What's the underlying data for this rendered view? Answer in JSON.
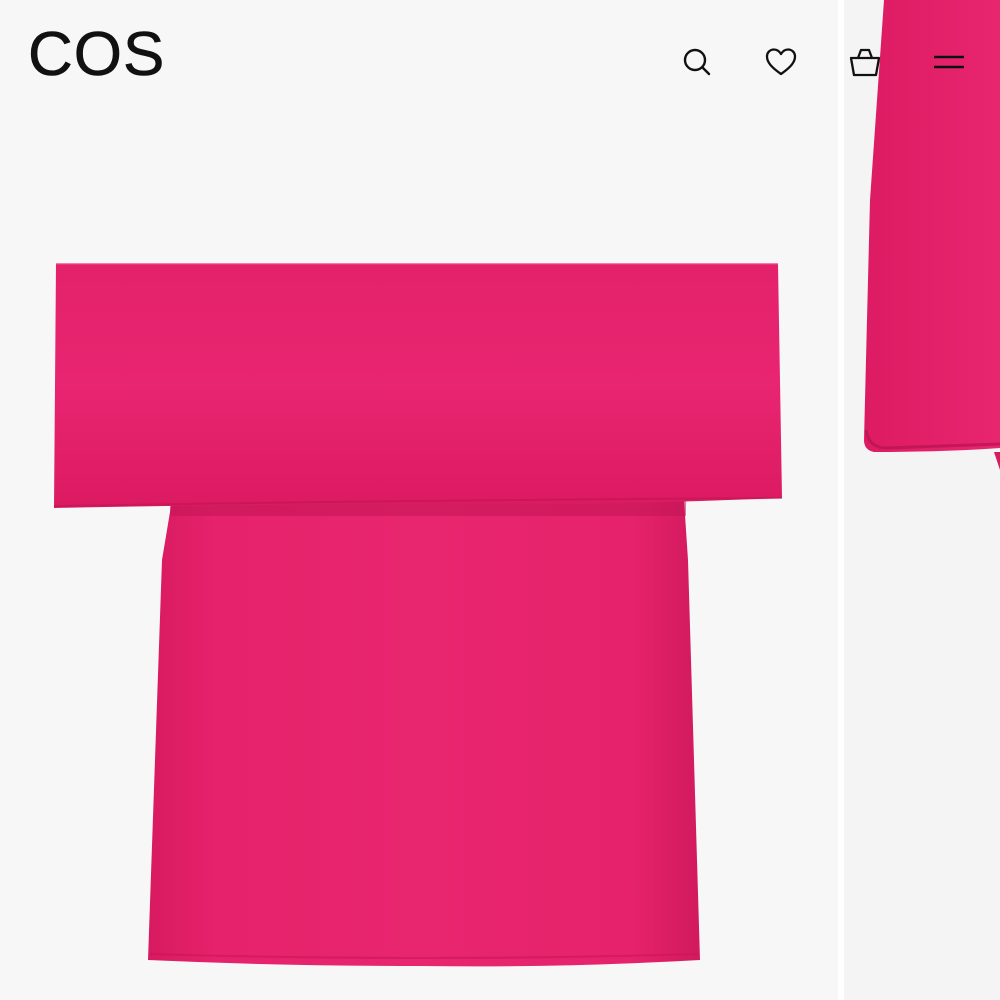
{
  "brand": {
    "logo_text": "COS"
  },
  "header": {
    "icons": {
      "search": "search-icon",
      "wishlist": "heart-icon",
      "bag": "shopping-bag-icon",
      "menu": "hamburger-menu-icon"
    }
  },
  "product": {
    "color": "#e5206b",
    "shadow_color": "#c91559",
    "highlight_color": "#ef3a80"
  },
  "theme": {
    "background": "#f7f7f7",
    "text": "#111111"
  }
}
